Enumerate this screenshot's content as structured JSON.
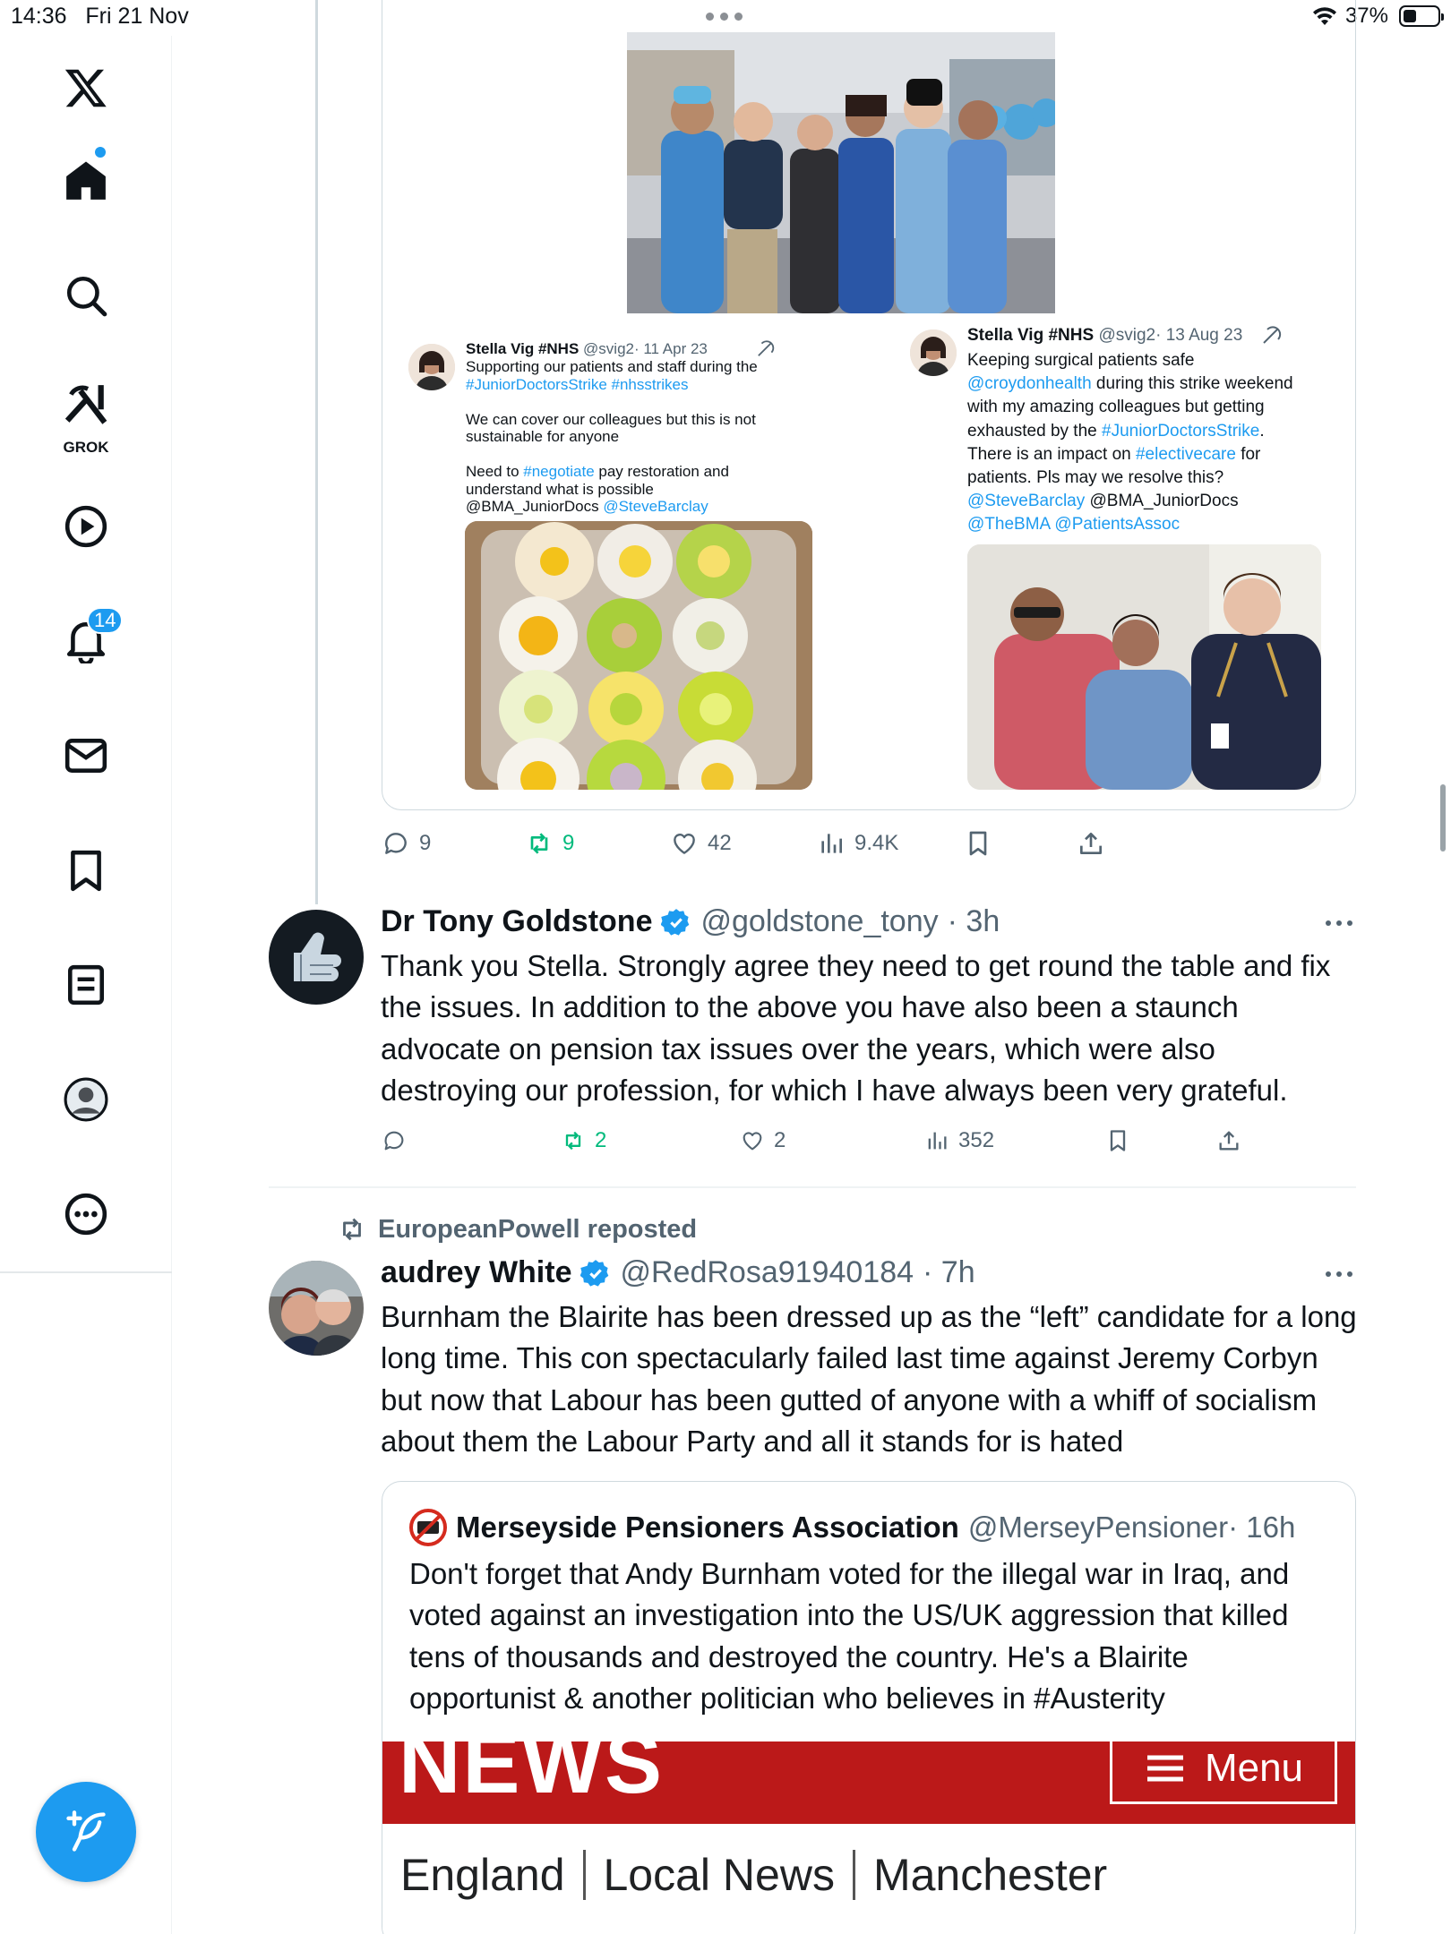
{
  "status_bar": {
    "time": "14:36",
    "date": "Fri 21 Nov",
    "battery_percent": "37%",
    "battery_level": 0.37
  },
  "sidebar": {
    "items": [
      {
        "name": "x-logo",
        "icon": "x-logo-icon"
      },
      {
        "name": "home",
        "icon": "home-icon",
        "has_dot": true
      },
      {
        "name": "explore",
        "icon": "search-icon"
      },
      {
        "name": "grok",
        "icon": "grok-icon",
        "label": "GROK"
      },
      {
        "name": "video",
        "icon": "play-icon"
      },
      {
        "name": "notifications",
        "icon": "bell-icon",
        "badge": "14"
      },
      {
        "name": "messages",
        "icon": "mail-icon"
      },
      {
        "name": "bookmarks",
        "icon": "bookmark-icon"
      },
      {
        "name": "lists",
        "icon": "list-icon"
      },
      {
        "name": "profile",
        "icon": "avatar-icon"
      },
      {
        "name": "more",
        "icon": "more-icon"
      }
    ],
    "compose_icon": "compose-icon"
  },
  "colors": {
    "accent": "#1d9bf0",
    "repost_green": "#00ba7c",
    "text": "#0f1419",
    "secondary": "#536471",
    "bbc_red": "#bb1919"
  },
  "quoted_images": {
    "left_tweet": {
      "name": "Stella Vig #NHS",
      "handle": "@svig2",
      "date": "· 11 Apr 23",
      "lines": [
        "Supporting our patients and staff during the",
        "#JuniorDoctorsStrike #nhsstrikes",
        "",
        "We can cover our colleagues but this is not",
        "sustainable for anyone",
        "",
        "Need to #negotiate pay restoration and",
        "understand what is possible",
        "@BMA_JuniorDocs @SteveBarclay"
      ]
    },
    "right_tweet": {
      "name": "Stella Vig #NHS",
      "handle": "@svig2",
      "date": "· 13 Aug 23",
      "text_plain_1": "Keeping surgical patients safe",
      "link_1": "@croydonhealth",
      "text_plain_2": " during this strike weekend",
      "text_plain_3": "with my amazing colleagues but getting",
      "text_plain_4": "exhausted by the ",
      "link_2": "#JuniorDoctorsStrike",
      "text_plain_5": ".",
      "text_plain_6": "There is an impact on ",
      "link_3": "#electivecare",
      "text_plain_7": " for",
      "text_plain_8": "patients. Pls may we resolve this?",
      "link_4": "@SteveBarclay",
      "text_plain_9": " @BMA_JuniorDocs",
      "link_5": "@TheBMA @PatientsAssoc"
    }
  },
  "parent_actions": {
    "replies": "9",
    "reposts": "9",
    "likes": "42",
    "views": "9.4K"
  },
  "reply_tweet": {
    "name": "Dr Tony Goldstone",
    "handle": "@goldstone_tony",
    "time": "· 3h",
    "text": "Thank you Stella. Strongly agree they need to get round the table and fix the issues. In addition to the above you have also been a staunch advocate on pension tax issues over the years, which were also destroying our profession, for which I have always been very grateful.",
    "replies": "",
    "reposts": "2",
    "likes": "2",
    "views": "352"
  },
  "repost_tweet": {
    "reposted_by": "EuropeanPowell reposted",
    "name": "audrey White",
    "handle": "@RedRosa91940184",
    "time": "· 7h",
    "text": "Burnham the Blairite has been dressed up as the “left” candidate for a long long time. This con spectacularly failed last time against Jeremy Corbyn but now that Labour has been gutted of anyone with a whiff of socialism about them the Labour Party and all it stands for is hated",
    "quote": {
      "name": "Merseyside Pensioners Association",
      "handle": "@MerseyPensioner",
      "time": "· 16h",
      "text": "Don't forget that Andy Burnham voted for the illegal war in Iraq, and voted against an investigation into the US/UK aggression that killed tens of thousands and destroyed the country. He's a Blairite opportunist & another politician who believes in #Austerity",
      "image": {
        "banner_word": "NEWS",
        "menu_label": "Menu",
        "nav": [
          "England",
          "Local News",
          "Manchester"
        ]
      }
    }
  }
}
